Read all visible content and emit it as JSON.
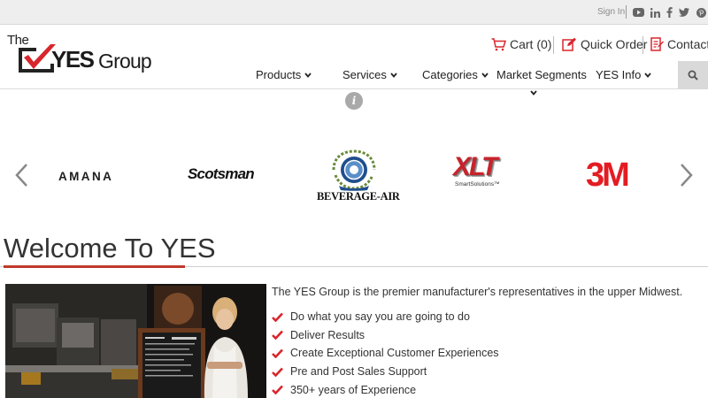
{
  "topbar": {
    "signin": "Sign In",
    "social_icons": [
      "youtube-icon",
      "linkedin-icon",
      "facebook-icon",
      "twitter-icon",
      "pinterest-icon"
    ]
  },
  "header": {
    "logo": {
      "the": "The",
      "yes": "YES",
      "group": "Group"
    },
    "cart_label": "Cart",
    "cart_count": "(0)",
    "quick_order_label": "Quick Order",
    "contact_label": "Contact",
    "nav": [
      {
        "label": "Products",
        "has_caret": true
      },
      {
        "label": "Services",
        "has_caret": true
      },
      {
        "label": "Categories",
        "has_caret": true
      },
      {
        "label": "Market Segments",
        "has_caret": false
      },
      {
        "label": "YES Info",
        "has_caret": true
      }
    ]
  },
  "carousel": {
    "brands": [
      "AMANA",
      "Scotsman",
      "BEVERAGE-AIR",
      "XLT",
      "SmartSolutions™",
      "3M"
    ]
  },
  "welcome": {
    "title": "Welcome To YES",
    "intro": "The YES Group is the premier manufacturer's representatives in the upper Midwest.",
    "features": [
      "Do what you say you are going to do",
      "Deliver Results",
      "Create Exceptional Customer Experiences",
      "Pre and Post Sales Support",
      "350+ years of Experience"
    ]
  },
  "colors": {
    "accent": "#d8262d",
    "text": "#333333",
    "topbar": "#eeeeee"
  }
}
